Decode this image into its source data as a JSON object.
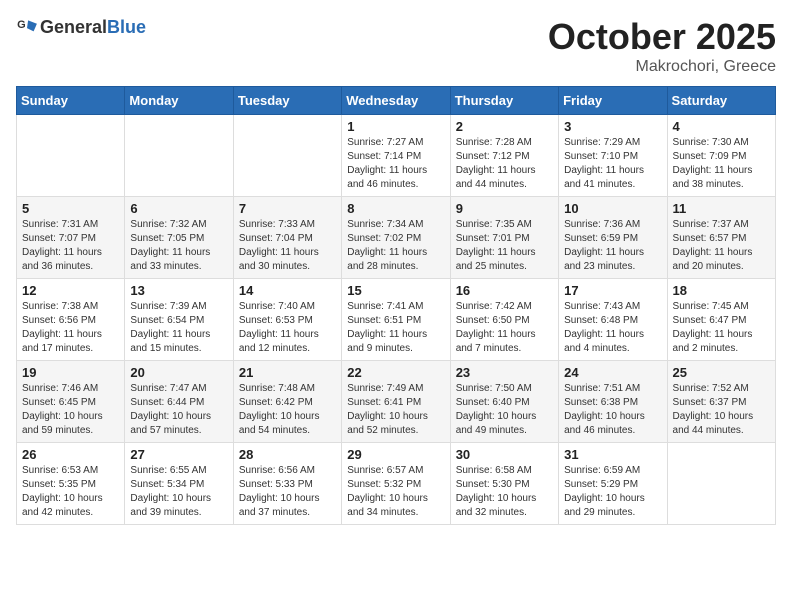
{
  "header": {
    "logo_general": "General",
    "logo_blue": "Blue",
    "title": "October 2025",
    "subtitle": "Makrochori, Greece"
  },
  "weekdays": [
    "Sunday",
    "Monday",
    "Tuesday",
    "Wednesday",
    "Thursday",
    "Friday",
    "Saturday"
  ],
  "weeks": [
    [
      {
        "day": "",
        "info": ""
      },
      {
        "day": "",
        "info": ""
      },
      {
        "day": "",
        "info": ""
      },
      {
        "day": "1",
        "info": "Sunrise: 7:27 AM\nSunset: 7:14 PM\nDaylight: 11 hours\nand 46 minutes."
      },
      {
        "day": "2",
        "info": "Sunrise: 7:28 AM\nSunset: 7:12 PM\nDaylight: 11 hours\nand 44 minutes."
      },
      {
        "day": "3",
        "info": "Sunrise: 7:29 AM\nSunset: 7:10 PM\nDaylight: 11 hours\nand 41 minutes."
      },
      {
        "day": "4",
        "info": "Sunrise: 7:30 AM\nSunset: 7:09 PM\nDaylight: 11 hours\nand 38 minutes."
      }
    ],
    [
      {
        "day": "5",
        "info": "Sunrise: 7:31 AM\nSunset: 7:07 PM\nDaylight: 11 hours\nand 36 minutes."
      },
      {
        "day": "6",
        "info": "Sunrise: 7:32 AM\nSunset: 7:05 PM\nDaylight: 11 hours\nand 33 minutes."
      },
      {
        "day": "7",
        "info": "Sunrise: 7:33 AM\nSunset: 7:04 PM\nDaylight: 11 hours\nand 30 minutes."
      },
      {
        "day": "8",
        "info": "Sunrise: 7:34 AM\nSunset: 7:02 PM\nDaylight: 11 hours\nand 28 minutes."
      },
      {
        "day": "9",
        "info": "Sunrise: 7:35 AM\nSunset: 7:01 PM\nDaylight: 11 hours\nand 25 minutes."
      },
      {
        "day": "10",
        "info": "Sunrise: 7:36 AM\nSunset: 6:59 PM\nDaylight: 11 hours\nand 23 minutes."
      },
      {
        "day": "11",
        "info": "Sunrise: 7:37 AM\nSunset: 6:57 PM\nDaylight: 11 hours\nand 20 minutes."
      }
    ],
    [
      {
        "day": "12",
        "info": "Sunrise: 7:38 AM\nSunset: 6:56 PM\nDaylight: 11 hours\nand 17 minutes."
      },
      {
        "day": "13",
        "info": "Sunrise: 7:39 AM\nSunset: 6:54 PM\nDaylight: 11 hours\nand 15 minutes."
      },
      {
        "day": "14",
        "info": "Sunrise: 7:40 AM\nSunset: 6:53 PM\nDaylight: 11 hours\nand 12 minutes."
      },
      {
        "day": "15",
        "info": "Sunrise: 7:41 AM\nSunset: 6:51 PM\nDaylight: 11 hours\nand 9 minutes."
      },
      {
        "day": "16",
        "info": "Sunrise: 7:42 AM\nSunset: 6:50 PM\nDaylight: 11 hours\nand 7 minutes."
      },
      {
        "day": "17",
        "info": "Sunrise: 7:43 AM\nSunset: 6:48 PM\nDaylight: 11 hours\nand 4 minutes."
      },
      {
        "day": "18",
        "info": "Sunrise: 7:45 AM\nSunset: 6:47 PM\nDaylight: 11 hours\nand 2 minutes."
      }
    ],
    [
      {
        "day": "19",
        "info": "Sunrise: 7:46 AM\nSunset: 6:45 PM\nDaylight: 10 hours\nand 59 minutes."
      },
      {
        "day": "20",
        "info": "Sunrise: 7:47 AM\nSunset: 6:44 PM\nDaylight: 10 hours\nand 57 minutes."
      },
      {
        "day": "21",
        "info": "Sunrise: 7:48 AM\nSunset: 6:42 PM\nDaylight: 10 hours\nand 54 minutes."
      },
      {
        "day": "22",
        "info": "Sunrise: 7:49 AM\nSunset: 6:41 PM\nDaylight: 10 hours\nand 52 minutes."
      },
      {
        "day": "23",
        "info": "Sunrise: 7:50 AM\nSunset: 6:40 PM\nDaylight: 10 hours\nand 49 minutes."
      },
      {
        "day": "24",
        "info": "Sunrise: 7:51 AM\nSunset: 6:38 PM\nDaylight: 10 hours\nand 46 minutes."
      },
      {
        "day": "25",
        "info": "Sunrise: 7:52 AM\nSunset: 6:37 PM\nDaylight: 10 hours\nand 44 minutes."
      }
    ],
    [
      {
        "day": "26",
        "info": "Sunrise: 6:53 AM\nSunset: 5:35 PM\nDaylight: 10 hours\nand 42 minutes."
      },
      {
        "day": "27",
        "info": "Sunrise: 6:55 AM\nSunset: 5:34 PM\nDaylight: 10 hours\nand 39 minutes."
      },
      {
        "day": "28",
        "info": "Sunrise: 6:56 AM\nSunset: 5:33 PM\nDaylight: 10 hours\nand 37 minutes."
      },
      {
        "day": "29",
        "info": "Sunrise: 6:57 AM\nSunset: 5:32 PM\nDaylight: 10 hours\nand 34 minutes."
      },
      {
        "day": "30",
        "info": "Sunrise: 6:58 AM\nSunset: 5:30 PM\nDaylight: 10 hours\nand 32 minutes."
      },
      {
        "day": "31",
        "info": "Sunrise: 6:59 AM\nSunset: 5:29 PM\nDaylight: 10 hours\nand 29 minutes."
      },
      {
        "day": "",
        "info": ""
      }
    ]
  ]
}
